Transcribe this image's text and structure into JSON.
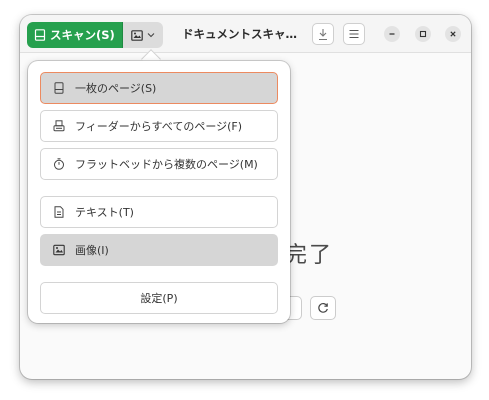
{
  "headerbar": {
    "scan_label": "スキャン(S)",
    "title": "ドキュメントスキャ…"
  },
  "content": {
    "status_text": "完了"
  },
  "menu": {
    "items": [
      {
        "label": "一枚のページ(S)",
        "icon": "single-page-icon"
      },
      {
        "label": "フィーダーからすべてのページ(F)",
        "icon": "feeder-icon"
      },
      {
        "label": "フラットベッドから複数のページ(M)",
        "icon": "timer-icon"
      },
      {
        "label": "テキスト(T)",
        "icon": "text-document-icon"
      },
      {
        "label": "画像(I)",
        "icon": "image-icon"
      },
      {
        "label": "設定(P)"
      }
    ]
  },
  "colors": {
    "accent": "#26a04e",
    "selected_border": "#ec8a60"
  }
}
